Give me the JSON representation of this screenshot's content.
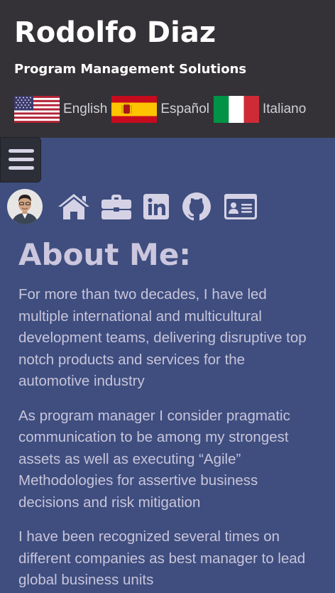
{
  "header": {
    "title": "Rodolfo Diaz",
    "subtitle": "Program Management Solutions",
    "languages": [
      {
        "label": "English",
        "flag": "us-flag-icon"
      },
      {
        "label": "Español",
        "flag": "spain-flag-icon"
      },
      {
        "label": "Italiano",
        "flag": "italy-flag-icon"
      }
    ]
  },
  "nav": {
    "menu_icon": "hamburger-menu-icon",
    "icons": [
      "avatar",
      "home-icon",
      "briefcase-icon",
      "linkedin-icon",
      "github-icon",
      "contact-card-icon"
    ]
  },
  "main": {
    "heading": "About Me:",
    "paragraphs": [
      "For more than two decades, I have led multiple international and multicultural development teams, delivering disruptive top notch products and services for the automotive industry",
      "As program manager I consider pragmatic communication to be among my strongest assets as well as executing “Agile” Methodologies for assertive business decisions and risk mitigation",
      "I have been recognized several times on different companies as best manager to lead global business units"
    ]
  },
  "colors": {
    "header_bg": "#343236",
    "page_bg": "#3f4e7f",
    "text": "#c8c4da",
    "icon": "#d6d2e6"
  }
}
